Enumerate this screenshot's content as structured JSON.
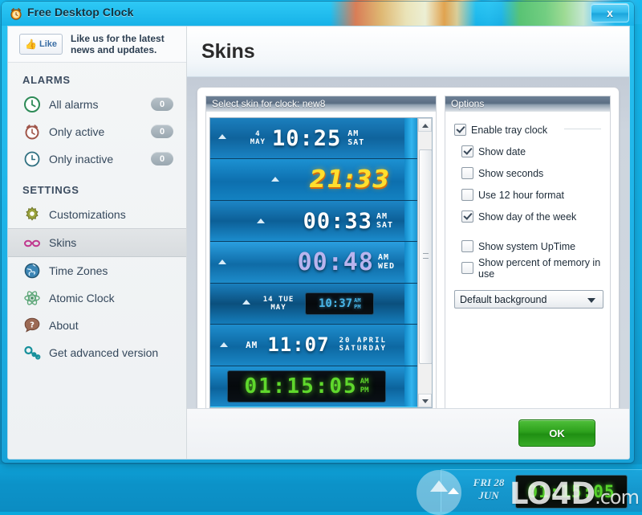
{
  "window": {
    "title": "Free Desktop Clock",
    "icon": "alarm-clock-icon",
    "close_label": "x"
  },
  "sidebar": {
    "like": {
      "button_label": "Like",
      "thumb_icon": "thumbs-up-icon",
      "text": "Like us for the latest news and updates."
    },
    "sections": [
      {
        "heading": "ALARMS",
        "items": [
          {
            "label": "All alarms",
            "badge": "0",
            "icon": "clock-icon"
          },
          {
            "label": "Only active",
            "badge": "0",
            "icon": "alarm-clock-icon"
          },
          {
            "label": "Only inactive",
            "badge": "0",
            "icon": "clock-outline-icon"
          }
        ]
      },
      {
        "heading": "SETTINGS",
        "items": [
          {
            "label": "Customizations",
            "icon": "gear-icon"
          },
          {
            "label": "Skins",
            "icon": "glasses-icon",
            "selected": true
          },
          {
            "label": "Time Zones",
            "icon": "globe-icon"
          },
          {
            "label": "Atomic Clock",
            "icon": "atom-icon"
          },
          {
            "label": "About",
            "icon": "question-icon"
          },
          {
            "label": "Get advanced version",
            "icon": "key-icon"
          }
        ]
      }
    ]
  },
  "main": {
    "page_title": "Skins",
    "skins_group": {
      "header": "Select skin for clock: new8",
      "rows": [
        {
          "style": "a",
          "date_top": "4",
          "date_bottom": "MAY",
          "time": "10:25",
          "ampm_top": "AM",
          "ampm_bottom": "SAT"
        },
        {
          "style": "b",
          "time": "21:33"
        },
        {
          "style": "c",
          "time": "00:33",
          "ampm_top": "AM",
          "ampm_bottom": "SAT"
        },
        {
          "style": "d",
          "time": "00:48",
          "ampm_top": "AM",
          "ampm_bottom": "WED"
        },
        {
          "style": "e",
          "date_top": "14 TUE",
          "date_bottom": "MAY",
          "time": "10:37",
          "ampm_top": "AM",
          "ampm_bottom": "PM"
        },
        {
          "style": "f",
          "ampm_top": "AM",
          "time": "11:07",
          "date_top": "20 APRIL",
          "date_bottom": "SATURDAY"
        },
        {
          "style": "g",
          "time": "01:15:05",
          "ampm_top": "AM",
          "ampm_bottom": "PM",
          "selected": true
        }
      ],
      "scrollbar": {
        "up_icon": "scroll-up-arrow-icon",
        "down_icon": "scroll-down-arrow-icon"
      }
    },
    "options_group": {
      "header": "Options",
      "checkboxes": [
        {
          "label": "Enable tray clock",
          "checked": true,
          "indent": false,
          "gap": false
        },
        {
          "label": "Show date",
          "checked": true,
          "indent": true,
          "gap": false
        },
        {
          "label": "Show seconds",
          "checked": false,
          "indent": true,
          "gap": false
        },
        {
          "label": "Use 12 hour format",
          "checked": false,
          "indent": true,
          "gap": false
        },
        {
          "label": "Show day of the week",
          "checked": true,
          "indent": true,
          "gap": false
        },
        {
          "label": "Show system UpTime",
          "checked": false,
          "indent": true,
          "gap": true
        },
        {
          "label": "Show percent of memory in use",
          "checked": false,
          "indent": true,
          "gap": false
        }
      ],
      "background_select": {
        "value": "Default background",
        "arrow_icon": "chevron-down-icon"
      }
    },
    "footer": {
      "ok_label": "OK"
    }
  },
  "desktop": {
    "tray_clock": {
      "date_line1": "FRI 28",
      "date_line2": "JUN",
      "lcd_time": "01:15:05",
      "arrow_icon": "tray-up-arrow-icon"
    },
    "watermark": {
      "text": "LO4D",
      "suffix": ".com"
    }
  },
  "colors": {
    "accent_blue": "#17a2d8",
    "ok_green": "#2da11c",
    "title_bar": "#2ec9f5",
    "panel_bg": "#d2d9e1"
  }
}
